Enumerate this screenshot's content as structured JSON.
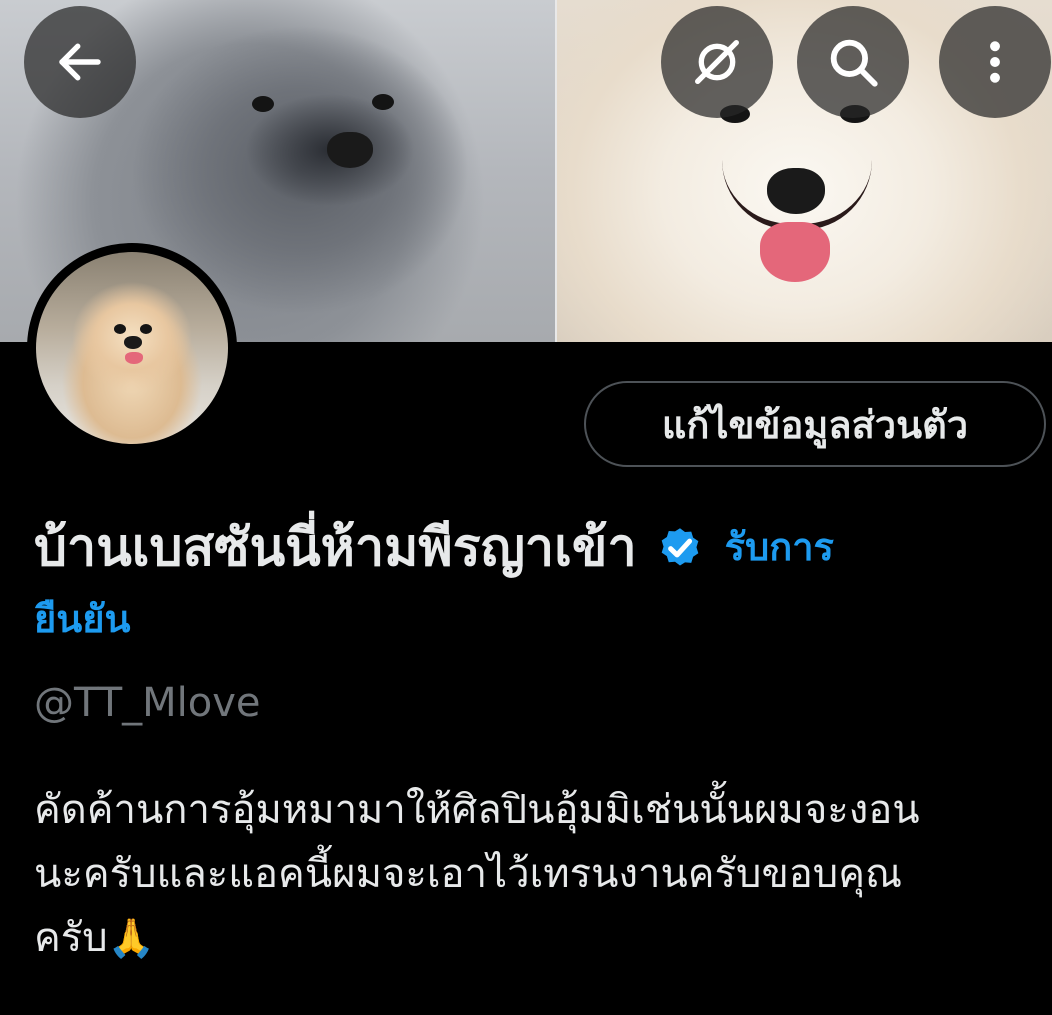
{
  "header": {
    "back_icon": "arrow-left-icon",
    "hide_icon": "eye-off-icon",
    "search_icon": "search-icon",
    "more_icon": "more-vertical-icon"
  },
  "profile": {
    "edit_button_label": "แก้ไขข้อมูลส่วนตัว",
    "display_name": "บ้านเบสซันนี่ห้ามพีรญาเข้า",
    "verified_badge": "verified-check-icon",
    "verify_link_part1": "รับการ",
    "verify_link_part2": "ยืนยัน",
    "handle": "@TT_Mlove",
    "bio_lines": [
      "คัดค้านการอุ้มหมามาให้ศิลปินอุ้มมิเช่นนั้นผมจะงอน",
      "นะครับและแอคนี้ผมจะเอาไว้เทรนงานครับขอบคุณ",
      "ครับ"
    ],
    "bio_emoji": "🙏"
  },
  "colors": {
    "accent": "#1d9bf0",
    "text_primary": "#e7e9ea",
    "text_secondary": "#71767b",
    "background": "#000000",
    "button_border": "#4d5257"
  }
}
